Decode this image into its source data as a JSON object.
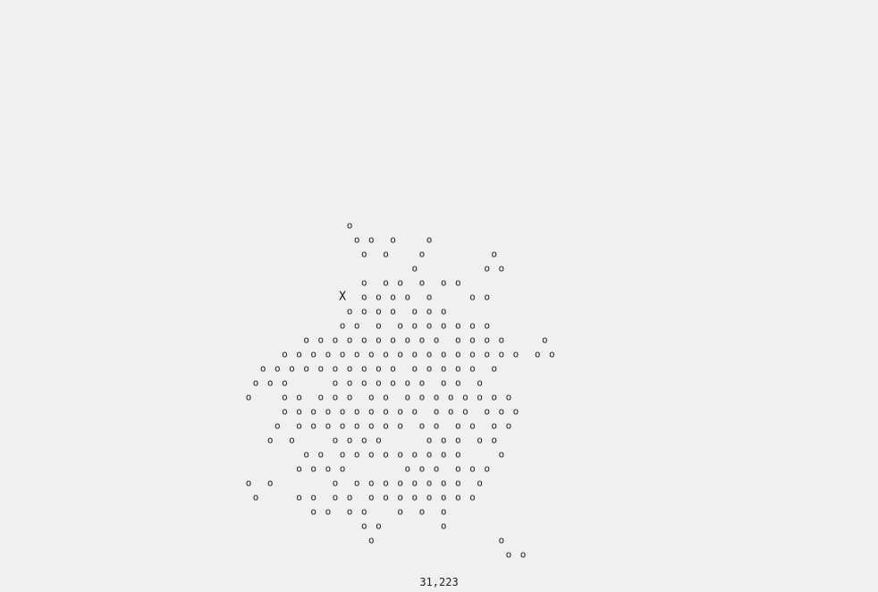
{
  "symbols": {
    "pebble": "o",
    "player": "X"
  },
  "status": {
    "coordinates": "31,223"
  },
  "grid": {
    "rows": [
      "              o",
      "               o o  o    o",
      "                o  o    o         o",
      "                       o         o o",
      "                o  o o  o  o o",
      "             X  o o o o  o     o o",
      "              o o o o  o o o",
      "             o o  o  o o o o o o o",
      "        o o o o o o o o o o  o o o o     o",
      "     o o o o o o o o o o o o o o o o o  o o",
      "  o o o o o o o o o o  o o o o o  o",
      " o o o      o o o o o o o  o o  o",
      "o    o o  o o o  o o  o o o o o o o o",
      "     o o o o o o o o o o  o o o  o o o",
      "    o  o o o o o o o o  o o  o o  o o",
      "   o  o     o o o o      o o o  o o",
      "        o o  o o o o o o o o o     o",
      "       o o o o        o o o  o o o",
      "o  o        o  o o o o o o o o  o",
      " o     o o  o o  o o o o o o o o",
      "         o o  o o    o  o  o",
      "                o o        o",
      "                 o                 o",
      "                                    o o"
    ]
  }
}
